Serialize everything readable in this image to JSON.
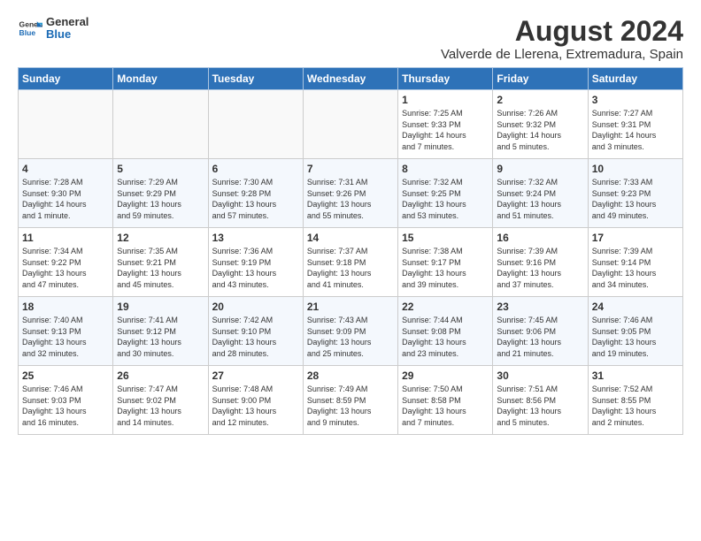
{
  "header": {
    "logo_general": "General",
    "logo_blue": "Blue",
    "month_year": "August 2024",
    "location": "Valverde de Llerena, Extremadura, Spain"
  },
  "days_of_week": [
    "Sunday",
    "Monday",
    "Tuesday",
    "Wednesday",
    "Thursday",
    "Friday",
    "Saturday"
  ],
  "weeks": [
    [
      {
        "day": "",
        "text": ""
      },
      {
        "day": "",
        "text": ""
      },
      {
        "day": "",
        "text": ""
      },
      {
        "day": "",
        "text": ""
      },
      {
        "day": "1",
        "text": "Sunrise: 7:25 AM\nSunset: 9:33 PM\nDaylight: 14 hours\nand 7 minutes."
      },
      {
        "day": "2",
        "text": "Sunrise: 7:26 AM\nSunset: 9:32 PM\nDaylight: 14 hours\nand 5 minutes."
      },
      {
        "day": "3",
        "text": "Sunrise: 7:27 AM\nSunset: 9:31 PM\nDaylight: 14 hours\nand 3 minutes."
      }
    ],
    [
      {
        "day": "4",
        "text": "Sunrise: 7:28 AM\nSunset: 9:30 PM\nDaylight: 14 hours\nand 1 minute."
      },
      {
        "day": "5",
        "text": "Sunrise: 7:29 AM\nSunset: 9:29 PM\nDaylight: 13 hours\nand 59 minutes."
      },
      {
        "day": "6",
        "text": "Sunrise: 7:30 AM\nSunset: 9:28 PM\nDaylight: 13 hours\nand 57 minutes."
      },
      {
        "day": "7",
        "text": "Sunrise: 7:31 AM\nSunset: 9:26 PM\nDaylight: 13 hours\nand 55 minutes."
      },
      {
        "day": "8",
        "text": "Sunrise: 7:32 AM\nSunset: 9:25 PM\nDaylight: 13 hours\nand 53 minutes."
      },
      {
        "day": "9",
        "text": "Sunrise: 7:32 AM\nSunset: 9:24 PM\nDaylight: 13 hours\nand 51 minutes."
      },
      {
        "day": "10",
        "text": "Sunrise: 7:33 AM\nSunset: 9:23 PM\nDaylight: 13 hours\nand 49 minutes."
      }
    ],
    [
      {
        "day": "11",
        "text": "Sunrise: 7:34 AM\nSunset: 9:22 PM\nDaylight: 13 hours\nand 47 minutes."
      },
      {
        "day": "12",
        "text": "Sunrise: 7:35 AM\nSunset: 9:21 PM\nDaylight: 13 hours\nand 45 minutes."
      },
      {
        "day": "13",
        "text": "Sunrise: 7:36 AM\nSunset: 9:19 PM\nDaylight: 13 hours\nand 43 minutes."
      },
      {
        "day": "14",
        "text": "Sunrise: 7:37 AM\nSunset: 9:18 PM\nDaylight: 13 hours\nand 41 minutes."
      },
      {
        "day": "15",
        "text": "Sunrise: 7:38 AM\nSunset: 9:17 PM\nDaylight: 13 hours\nand 39 minutes."
      },
      {
        "day": "16",
        "text": "Sunrise: 7:39 AM\nSunset: 9:16 PM\nDaylight: 13 hours\nand 37 minutes."
      },
      {
        "day": "17",
        "text": "Sunrise: 7:39 AM\nSunset: 9:14 PM\nDaylight: 13 hours\nand 34 minutes."
      }
    ],
    [
      {
        "day": "18",
        "text": "Sunrise: 7:40 AM\nSunset: 9:13 PM\nDaylight: 13 hours\nand 32 minutes."
      },
      {
        "day": "19",
        "text": "Sunrise: 7:41 AM\nSunset: 9:12 PM\nDaylight: 13 hours\nand 30 minutes."
      },
      {
        "day": "20",
        "text": "Sunrise: 7:42 AM\nSunset: 9:10 PM\nDaylight: 13 hours\nand 28 minutes."
      },
      {
        "day": "21",
        "text": "Sunrise: 7:43 AM\nSunset: 9:09 PM\nDaylight: 13 hours\nand 25 minutes."
      },
      {
        "day": "22",
        "text": "Sunrise: 7:44 AM\nSunset: 9:08 PM\nDaylight: 13 hours\nand 23 minutes."
      },
      {
        "day": "23",
        "text": "Sunrise: 7:45 AM\nSunset: 9:06 PM\nDaylight: 13 hours\nand 21 minutes."
      },
      {
        "day": "24",
        "text": "Sunrise: 7:46 AM\nSunset: 9:05 PM\nDaylight: 13 hours\nand 19 minutes."
      }
    ],
    [
      {
        "day": "25",
        "text": "Sunrise: 7:46 AM\nSunset: 9:03 PM\nDaylight: 13 hours\nand 16 minutes."
      },
      {
        "day": "26",
        "text": "Sunrise: 7:47 AM\nSunset: 9:02 PM\nDaylight: 13 hours\nand 14 minutes."
      },
      {
        "day": "27",
        "text": "Sunrise: 7:48 AM\nSunset: 9:00 PM\nDaylight: 13 hours\nand 12 minutes."
      },
      {
        "day": "28",
        "text": "Sunrise: 7:49 AM\nSunset: 8:59 PM\nDaylight: 13 hours\nand 9 minutes."
      },
      {
        "day": "29",
        "text": "Sunrise: 7:50 AM\nSunset: 8:58 PM\nDaylight: 13 hours\nand 7 minutes."
      },
      {
        "day": "30",
        "text": "Sunrise: 7:51 AM\nSunset: 8:56 PM\nDaylight: 13 hours\nand 5 minutes."
      },
      {
        "day": "31",
        "text": "Sunrise: 7:52 AM\nSunset: 8:55 PM\nDaylight: 13 hours\nand 2 minutes."
      }
    ]
  ]
}
